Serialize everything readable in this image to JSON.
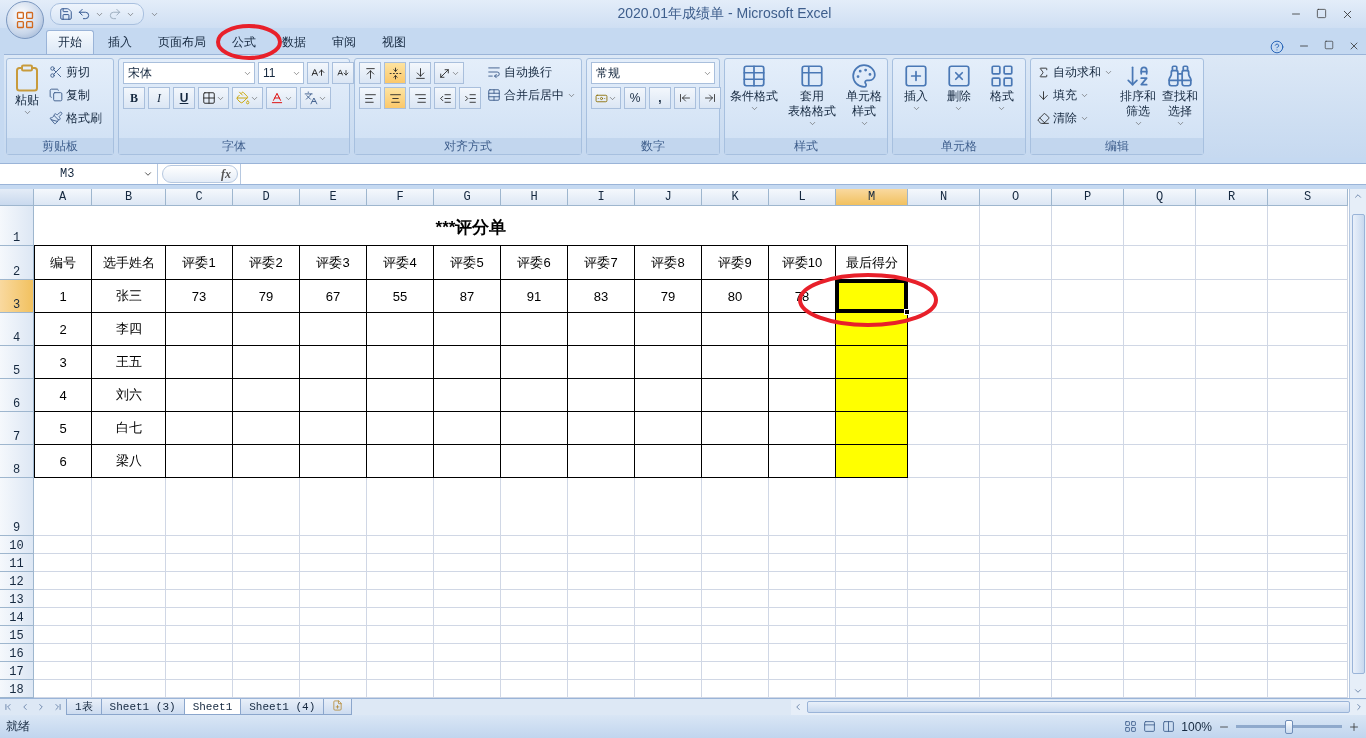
{
  "window": {
    "title": "2020.01年成绩单 - Microsoft Excel"
  },
  "ribbon": {
    "tabs": [
      {
        "label": "开始",
        "selected": true
      },
      {
        "label": "插入",
        "selected": false
      },
      {
        "label": "页面布局",
        "selected": false
      },
      {
        "label": "公式",
        "selected": false
      },
      {
        "label": "数据",
        "selected": false
      },
      {
        "label": "审阅",
        "selected": false
      },
      {
        "label": "视图",
        "selected": false
      }
    ],
    "clipboard": {
      "label": "剪贴板",
      "paste": "粘贴",
      "small": [
        "剪切",
        "复制",
        "格式刷"
      ]
    },
    "font": {
      "label": "字体",
      "font_name": "宋体",
      "font_size": "11",
      "bold": "B",
      "italic": "I",
      "underline": "U"
    },
    "alignment": {
      "label": "对齐方式",
      "vertical": [
        {
          "selected": false
        },
        {
          "selected": true
        },
        {
          "selected": false
        }
      ],
      "horizontal": [
        {
          "selected": false
        },
        {
          "selected": true
        },
        {
          "selected": false
        }
      ],
      "wrap": "自动换行",
      "merge": "合并后居中"
    },
    "number": {
      "label": "数字",
      "format": "常规",
      "percent": "%",
      "comma": ","
    },
    "styles": {
      "label": "样式",
      "buttons": [
        {
          "lines": [
            "条件格式"
          ]
        },
        {
          "lines": [
            "套用",
            "表格格式"
          ]
        },
        {
          "lines": [
            "单元格",
            "样式"
          ]
        }
      ]
    },
    "cells": {
      "label": "单元格",
      "buttons": [
        {
          "lines": [
            "插入"
          ]
        },
        {
          "lines": [
            "删除"
          ]
        },
        {
          "lines": [
            "格式"
          ]
        }
      ]
    },
    "editing": {
      "label": "编辑",
      "small": [
        "自动求和",
        "填充",
        "清除"
      ],
      "buttons": [
        {
          "lines": [
            "排序和",
            "筛选"
          ]
        },
        {
          "lines": [
            "查找和",
            "选择"
          ]
        }
      ]
    }
  },
  "formula_bar": {
    "name_box": "M3",
    "fx": "fx"
  },
  "sheet": {
    "columns": [
      {
        "label": "A",
        "selected": false
      },
      {
        "label": "B",
        "selected": false
      },
      {
        "label": "C",
        "selected": false
      },
      {
        "label": "D",
        "selected": false
      },
      {
        "label": "E",
        "selected": false
      },
      {
        "label": "F",
        "selected": false
      },
      {
        "label": "G",
        "selected": false
      },
      {
        "label": "H",
        "selected": false
      },
      {
        "label": "I",
        "selected": false
      },
      {
        "label": "J",
        "selected": false
      },
      {
        "label": "K",
        "selected": false
      },
      {
        "label": "L",
        "selected": false
      },
      {
        "label": "M",
        "selected": true
      },
      {
        "label": "N",
        "selected": false
      },
      {
        "label": "O",
        "selected": false
      },
      {
        "label": "P",
        "selected": false
      },
      {
        "label": "Q",
        "selected": false
      },
      {
        "label": "R",
        "selected": false
      },
      {
        "label": "S",
        "selected": false
      }
    ],
    "row_headers": [
      {
        "label": "1",
        "selected": false
      },
      {
        "label": "2",
        "selected": false
      },
      {
        "label": "3",
        "selected": true
      },
      {
        "label": "4",
        "selected": false
      },
      {
        "label": "5",
        "selected": false
      },
      {
        "label": "6",
        "selected": false
      },
      {
        "label": "7",
        "selected": false
      },
      {
        "label": "8",
        "selected": false
      },
      {
        "label": "9",
        "selected": false
      },
      {
        "label": "10",
        "selected": false
      },
      {
        "label": "11",
        "selected": false
      },
      {
        "label": "12",
        "selected": false
      },
      {
        "label": "13",
        "selected": false
      },
      {
        "label": "14",
        "selected": false
      },
      {
        "label": "15",
        "selected": false
      },
      {
        "label": "16",
        "selected": false
      },
      {
        "label": "17",
        "selected": false
      },
      {
        "label": "18",
        "selected": false
      }
    ],
    "title": "***评分单",
    "header": [
      "编号",
      "选手姓名",
      "评委1",
      "评委2",
      "评委3",
      "评委4",
      "评委5",
      "评委6",
      "评委7",
      "评委8",
      "评委9",
      "评委10",
      "最后得分"
    ],
    "rows": [
      {
        "values": [
          "1",
          "张三",
          "73",
          "79",
          "67",
          "55",
          "87",
          "91",
          "83",
          "79",
          "80",
          "78"
        ],
        "result_filled": true,
        "result_selected": true
      },
      {
        "values": [
          "2",
          "李四"
        ],
        "result_filled": true,
        "result_selected": false
      },
      {
        "values": [
          "3",
          "王五"
        ],
        "result_filled": true,
        "result_selected": false
      },
      {
        "values": [
          "4",
          "刘六"
        ],
        "result_filled": true,
        "result_selected": false
      },
      {
        "values": [
          "5",
          "白七"
        ],
        "result_filled": true,
        "result_selected": false
      },
      {
        "values": [
          "6",
          "梁八"
        ],
        "result_filled": true,
        "result_selected": false
      }
    ]
  },
  "sheet_tabs": [
    {
      "label": "1表",
      "selected": false
    },
    {
      "label": "Sheet1 (3)",
      "selected": false
    },
    {
      "label": "Sheet1",
      "selected": true
    },
    {
      "label": "Sheet1 (4)",
      "selected": false
    }
  ],
  "status_bar": {
    "status": "就绪",
    "zoom": "100%",
    "zoom_slider": {
      "level": 0.5
    }
  }
}
